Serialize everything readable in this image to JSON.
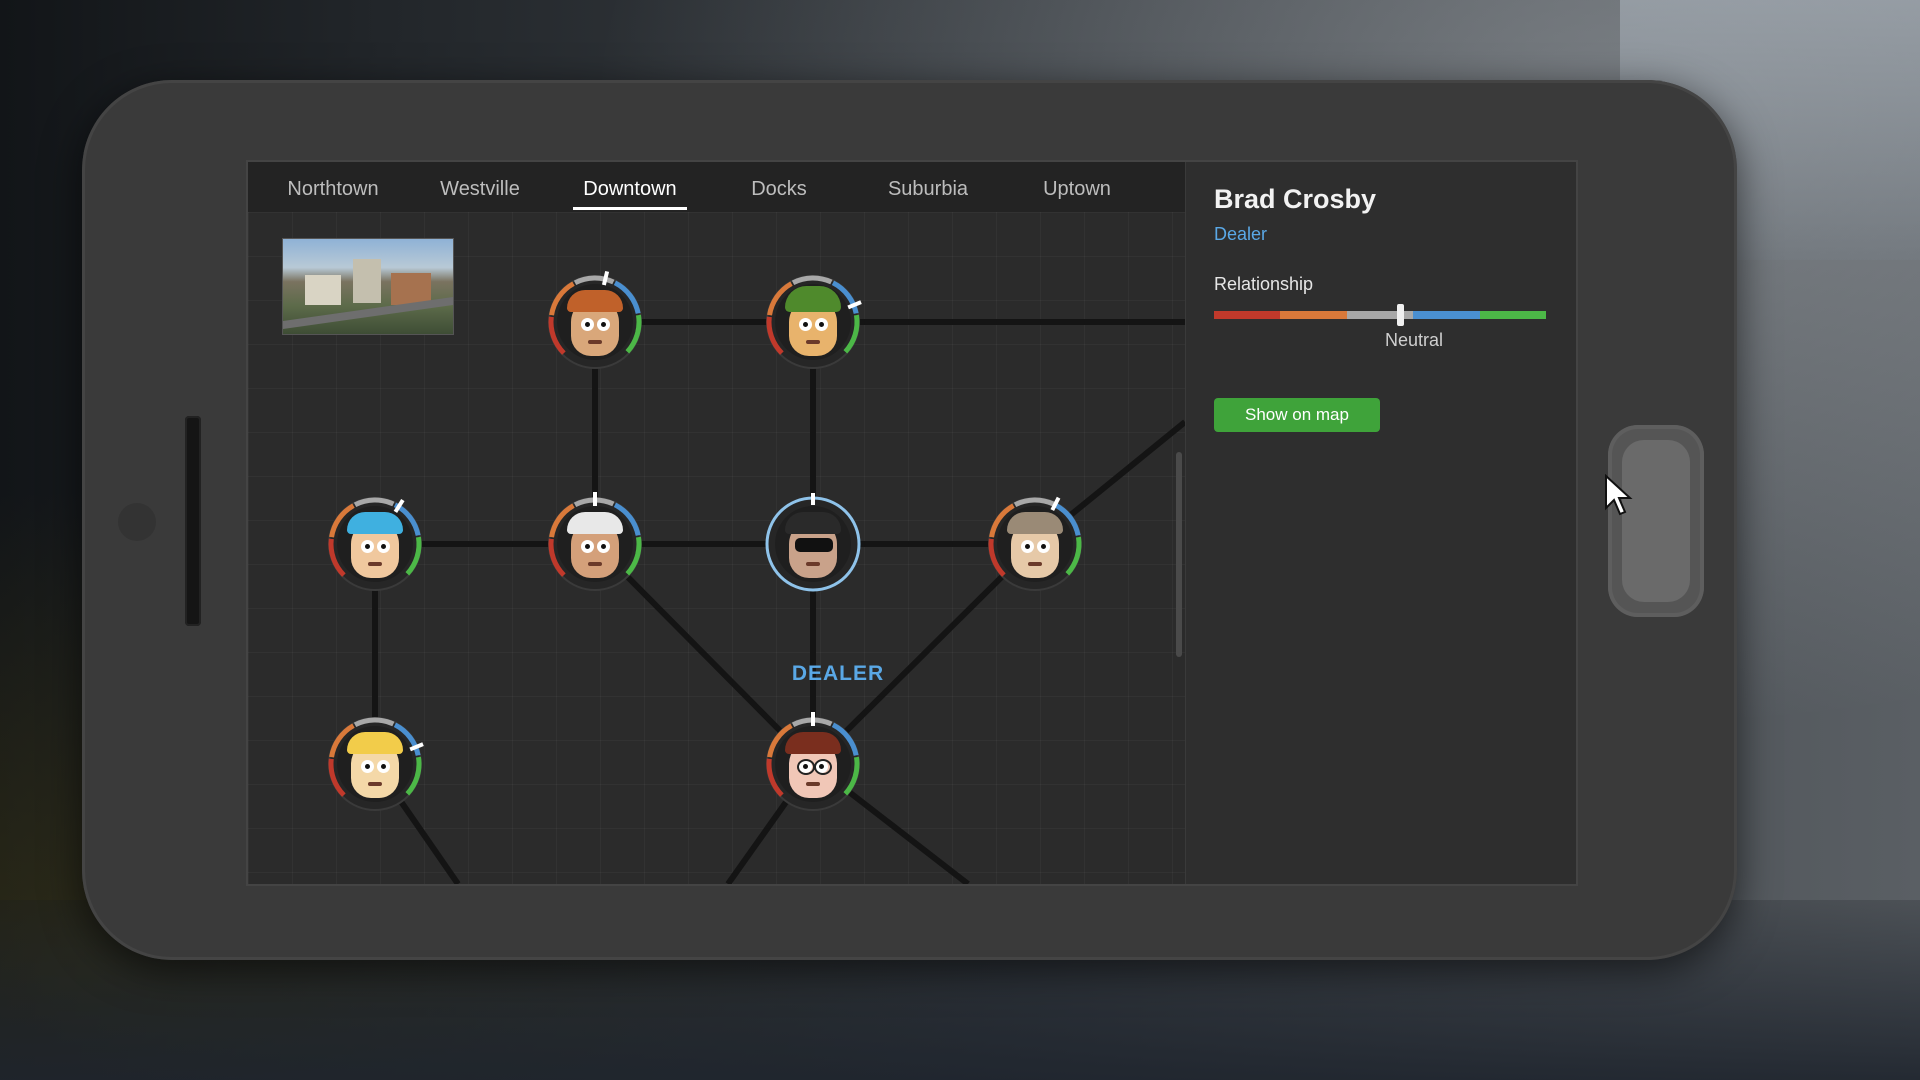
{
  "tabs": [
    {
      "label": "Northtown"
    },
    {
      "label": "Westville"
    },
    {
      "label": "Downtown",
      "active": true
    },
    {
      "label": "Docks"
    },
    {
      "label": "Suburbia"
    },
    {
      "label": "Uptown"
    }
  ],
  "network": {
    "area_thumbnail": "downtown-preview-image",
    "selected_label": "DEALER",
    "nodes": [
      {
        "id": "n1",
        "skin": "#d9a77a",
        "hair": "#c0612a",
        "relationship": 0.55
      },
      {
        "id": "n2",
        "skin": "#e8b36c",
        "hair": "#4f8a2c",
        "hat": true,
        "relationship": 0.75
      },
      {
        "id": "n3",
        "skin": "#f0c89e",
        "hair": "#3fb0e0",
        "relationship": 0.62
      },
      {
        "id": "n4",
        "skin": "#d4a07a",
        "hair": "#e8e8e8",
        "relationship": 0.5
      },
      {
        "id": "n5",
        "skin": "#c9a28a",
        "hair": "#2a2a2a",
        "selected": true,
        "relationship": 0.0
      },
      {
        "id": "n6",
        "skin": "#e6c9a8",
        "hair": "#9a8a76",
        "relationship": 0.6
      },
      {
        "id": "n7",
        "skin": "#f4d8a8",
        "hair": "#f2cc4a",
        "relationship": 0.75
      },
      {
        "id": "n8",
        "skin": "#f1c7b7",
        "hair": "#7a2e1e",
        "specs": true,
        "relationship": 0.5
      }
    ]
  },
  "detail": {
    "name": "Brad Crosby",
    "role": "Dealer",
    "relationship_label": "Relationship",
    "relationship_value": "Neutral",
    "relationship_level": 0.56,
    "relationship_colors": [
      "#c0392b",
      "#d9793a",
      "#a8a8a8",
      "#4a8fd0",
      "#4cb847"
    ],
    "show_on_map_label": "Show on map"
  }
}
